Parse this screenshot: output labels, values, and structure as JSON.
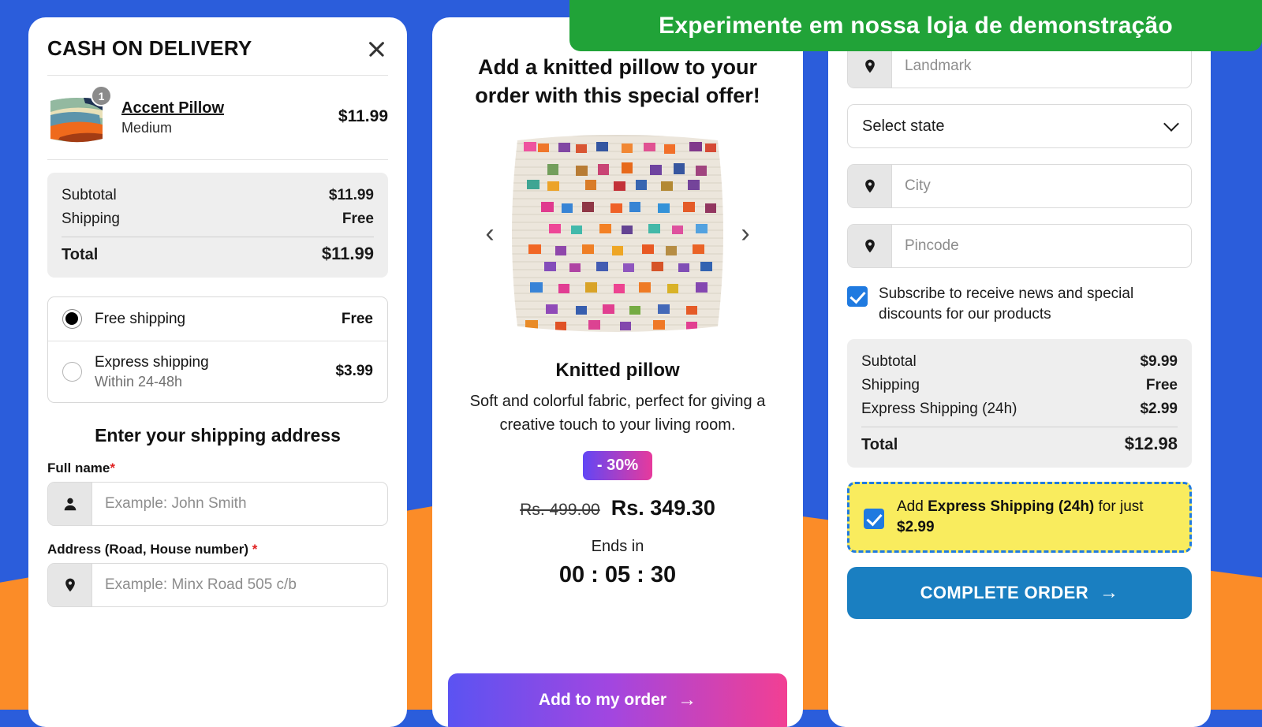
{
  "theme": {
    "bg_blue": "#2b5ddb",
    "bg_orange": "#fb8c28",
    "banner_green": "#21a338",
    "accent_blue": "#1f7ae0",
    "cta_blue": "#1a7fc1",
    "upsell_yellow": "#f9ec5e",
    "required_red": "#e02020"
  },
  "banner": {
    "text": "Experimente em nossa loja de demonstração"
  },
  "left_panel": {
    "title": "CASH ON DELIVERY",
    "close_label": "×",
    "cart_item": {
      "quantity": "1",
      "name": "Accent Pillow",
      "variant": "Medium",
      "price": "$11.99"
    },
    "summary": {
      "rows": [
        {
          "label": "Subtotal",
          "value": "$11.99"
        },
        {
          "label": "Shipping",
          "value": "Free"
        }
      ],
      "total_label": "Total",
      "total_value": "$11.99"
    },
    "shipping_options": [
      {
        "label": "Free shipping",
        "sub": "",
        "price": "Free",
        "selected": true
      },
      {
        "label": "Express shipping",
        "sub": "Within 24-48h",
        "price": "$3.99",
        "selected": false
      }
    ],
    "form_heading": "Enter your shipping address",
    "fields": [
      {
        "label": "Full name",
        "required": "*",
        "placeholder": "Example: John Smith",
        "value": "",
        "icon": "person-icon"
      },
      {
        "label": "Address (Road, House number)",
        "required": "*",
        "placeholder": "Example: Minx Road 505 c/b",
        "value": "",
        "icon": "location-pin-icon"
      }
    ]
  },
  "mid_panel": {
    "headline": "Add a knitted pillow to your order with this special offer!",
    "prev_arrow": "‹",
    "next_arrow": "›",
    "product_name": "Knitted pillow",
    "product_desc": "Soft and colorful fabric, perfect for giving a creative touch to your living room.",
    "discount_badge": "- 30%",
    "price_old": "Rs. 499.00",
    "price_new": "Rs. 349.30",
    "ends_in_label": "Ends in",
    "timer": "00 : 05 : 30",
    "cta_label": "Add to my order",
    "cta_arrow": "→"
  },
  "right_panel": {
    "fields": [
      {
        "placeholder": "Landmark",
        "value": "",
        "icon": "location-pin-icon"
      },
      {
        "placeholder": "City",
        "value": "",
        "icon": "location-pin-icon"
      },
      {
        "placeholder": "Pincode",
        "value": "",
        "icon": "location-pin-icon"
      }
    ],
    "state_select": {
      "value": "Select state",
      "chevron": "chevron-down-icon"
    },
    "subscribe": {
      "checked": true,
      "label": "Subscribe to receive news and special discounts for our products"
    },
    "summary": {
      "rows": [
        {
          "label": "Subtotal",
          "value": "$9.99"
        },
        {
          "label": "Shipping",
          "value": "Free"
        },
        {
          "label": "Express Shipping (24h)",
          "value": "$2.99"
        }
      ],
      "total_label": "Total",
      "total_value": "$12.98"
    },
    "upsell": {
      "checked": true,
      "prefix": "Add ",
      "bold1": "Express Shipping (24h)",
      "middle": " for just ",
      "bold2": "$2.99"
    },
    "cta_label": "COMPLETE ORDER",
    "cta_arrow": "→"
  }
}
